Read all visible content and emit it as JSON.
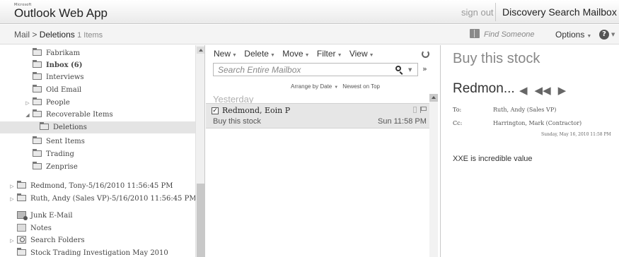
{
  "header": {
    "brand_small": "Microsoft",
    "app_title": "Outlook Web App",
    "sign_out": "sign out",
    "account": "Discovery Search Mailbox"
  },
  "breadcrumb": {
    "root": "Mail",
    "separator": ">",
    "current": "Deletions",
    "count": "1 Items"
  },
  "toolbar_right": {
    "find_someone": "Find Someone",
    "options": "Options",
    "help": "?"
  },
  "folders": [
    {
      "label": "Fabrikam",
      "indent": 2,
      "bold": false
    },
    {
      "label": "Inbox (6)",
      "indent": 2,
      "bold": true
    },
    {
      "label": "Interviews",
      "indent": 2,
      "bold": false
    },
    {
      "label": "Old Email",
      "indent": 2,
      "bold": false
    },
    {
      "label": "People",
      "indent": 2,
      "expander": "▷"
    },
    {
      "label": "Recoverable Items",
      "indent": 2,
      "expander": "◢"
    },
    {
      "label": "Deletions",
      "indent": 3,
      "selected": true
    },
    {
      "label": "Sent Items",
      "indent": 2
    },
    {
      "label": "Trading",
      "indent": 2
    },
    {
      "label": "Zenprise",
      "indent": 2
    },
    {
      "label": "Redmond, Tony-5/16/2010 11:56:45 PM",
      "indent": 0,
      "expander": "▷"
    },
    {
      "label": "Ruth, Andy (Sales VP)-5/16/2010 11:56:45 PM",
      "indent": 0,
      "expander": "▷"
    },
    {
      "label": "Junk E-Mail",
      "indent": 1,
      "icon": "junk"
    },
    {
      "label": "Notes",
      "indent": 1,
      "icon": "notes"
    },
    {
      "label": "Search Folders",
      "indent": 0,
      "expander": "▷",
      "icon": "search"
    },
    {
      "label": "Stock Trading Investigation May 2010",
      "indent": 1
    }
  ],
  "list_toolbar": {
    "new": "New",
    "delete": "Delete",
    "move": "Move",
    "filter": "Filter",
    "view": "View"
  },
  "search": {
    "placeholder": "Search Entire Mailbox"
  },
  "arrange": {
    "by": "Arrange by Date",
    "order": "Newest on Top"
  },
  "group_header": "Yesterday",
  "message": {
    "checked": "✓",
    "sender": "Redmond, Eoin P",
    "subject": "Buy this stock",
    "time": "Sun 11:58 PM"
  },
  "reading": {
    "subject": "Buy this stock",
    "sender": "Redmon...",
    "to_label": "To:",
    "to": "Ruth, Andy (Sales VP)",
    "cc_label": "Cc:",
    "cc": "Harrington, Mark (Contractor)",
    "date": "Sunday, May 16, 2010 11:58 PM",
    "body": "XXE is incredible value"
  }
}
